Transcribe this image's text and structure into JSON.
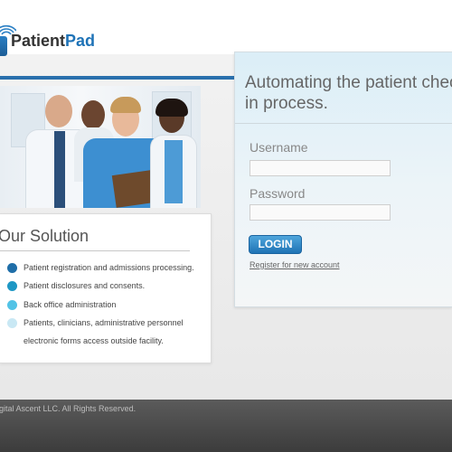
{
  "brand": {
    "name_part1": "Patient",
    "name_part2": "Pad"
  },
  "solution": {
    "title": "Our Solution",
    "items": [
      {
        "label": "Patient registration and admissions processing.",
        "color": "#1f6ea8"
      },
      {
        "label": "Patient disclosures and consents.",
        "color": "#1e97c4"
      },
      {
        "label": "Back office administration",
        "color": "#52c3e6"
      },
      {
        "label": "Patients, clinicians, administrative personnel",
        "color": "#c9e8f4"
      }
    ],
    "continuation": "electronic forms access outside facility."
  },
  "login": {
    "headline_line1": "Automating the patient check",
    "headline_line2": "in process.",
    "username_label": "Username",
    "password_label": "Password",
    "button_label": "LOGIN",
    "register_link": "Register for new account"
  },
  "footer": {
    "copyright": "igital Ascent LLC.  All Rights Reserved."
  }
}
